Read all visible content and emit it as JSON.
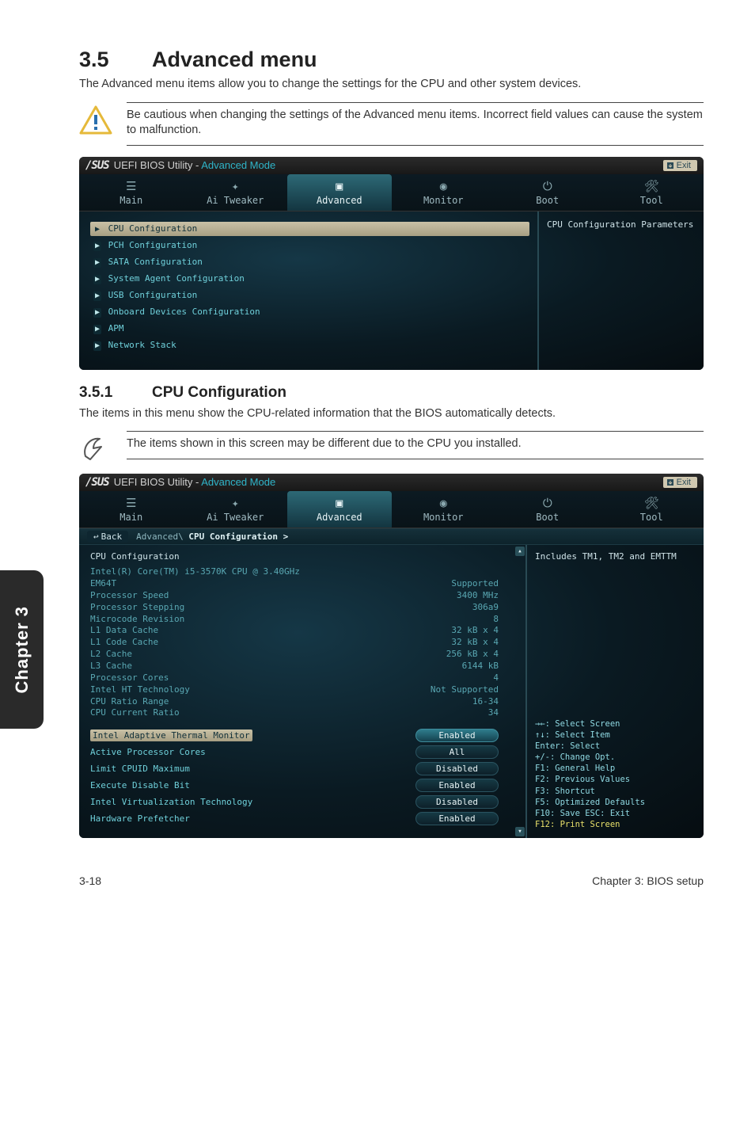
{
  "side_tab": "Chapter 3",
  "section": {
    "num": "3.5",
    "title": "Advanced menu"
  },
  "intro": "The Advanced menu items allow you to change the settings for the CPU and other system devices.",
  "caution": "Be cautious when changing the settings of the Advanced menu items. Incorrect field values can cause the system to malfunction.",
  "bios1": {
    "brand": "/SUS",
    "title": "UEFI BIOS Utility -",
    "mode": "Advanced Mode",
    "exit": "Exit",
    "tabs": {
      "main": "Main",
      "ai": "Ai Tweaker",
      "advanced": "Advanced",
      "monitor": "Monitor",
      "boot": "Boot",
      "tool": "Tool"
    },
    "menu": {
      "cpu": "CPU Configuration",
      "pch": "PCH Configuration",
      "sata": "SATA Configuration",
      "agent": "System Agent Configuration",
      "usb": "USB Configuration",
      "onboard": "Onboard Devices Configuration",
      "apm": "APM",
      "net": "Network Stack"
    },
    "right_desc": "CPU Configuration Parameters"
  },
  "subsection": {
    "num": "3.5.1",
    "title": "CPU Configuration"
  },
  "sub_intro": "The items in this menu show the CPU-related information that the BIOS automatically detects.",
  "note": "The items shown in this screen may be different due to the CPU you installed.",
  "bios2": {
    "back": "Back",
    "breadcrumb_prefix": "Advanced\\ ",
    "breadcrumb_current": "CPU Configuration >",
    "heading": "CPU Configuration",
    "cpu_line": "Intel(R) Core(TM) i5-3570K CPU @ 3.40GHz",
    "info": {
      "em64t": {
        "k": "EM64T",
        "v": "Supported"
      },
      "speed": {
        "k": "Processor Speed",
        "v": "3400 MHz"
      },
      "step": {
        "k": "Processor Stepping",
        "v": "306a9"
      },
      "micro": {
        "k": "Microcode Revision",
        "v": "8"
      },
      "l1d": {
        "k": "L1 Data Cache",
        "v": "32 kB x 4"
      },
      "l1c": {
        "k": "L1 Code Cache",
        "v": "32 kB x 4"
      },
      "l2": {
        "k": "L2 Cache",
        "v": "256 kB x 4"
      },
      "l3": {
        "k": "L3 Cache",
        "v": "6144 kB"
      },
      "cores": {
        "k": "Processor Cores",
        "v": "4"
      },
      "ht": {
        "k": "Intel HT Technology",
        "v": "Not Supported"
      },
      "range": {
        "k": "CPU Ratio Range",
        "v": "16-34"
      },
      "cur": {
        "k": "CPU Current Ratio",
        "v": "34"
      }
    },
    "opts": {
      "thermal": {
        "k": "Intel Adaptive Thermal Monitor",
        "v": "Enabled"
      },
      "active": {
        "k": "Active Processor Cores",
        "v": "All"
      },
      "cpuid": {
        "k": "Limit CPUID Maximum",
        "v": "Disabled"
      },
      "xd": {
        "k": "Execute Disable Bit",
        "v": "Enabled"
      },
      "vt": {
        "k": "Intel Virtualization Technology",
        "v": "Disabled"
      },
      "hwpf": {
        "k": "Hardware Prefetcher",
        "v": "Enabled"
      }
    },
    "right_desc": "Includes TM1, TM2 and EMTTM",
    "keys": {
      "l1": "→←: Select Screen",
      "l2": "↑↓: Select Item",
      "l3": "Enter: Select",
      "l4": "+/-: Change Opt.",
      "l5": "F1: General Help",
      "l6": "F2: Previous Values",
      "l7": "F3: Shortcut",
      "l8": "F5: Optimized Defaults",
      "l9": "F10: Save  ESC: Exit",
      "l10": "F12: Print Screen"
    }
  },
  "footer": {
    "left": "3-18",
    "right": "Chapter 3: BIOS setup"
  }
}
